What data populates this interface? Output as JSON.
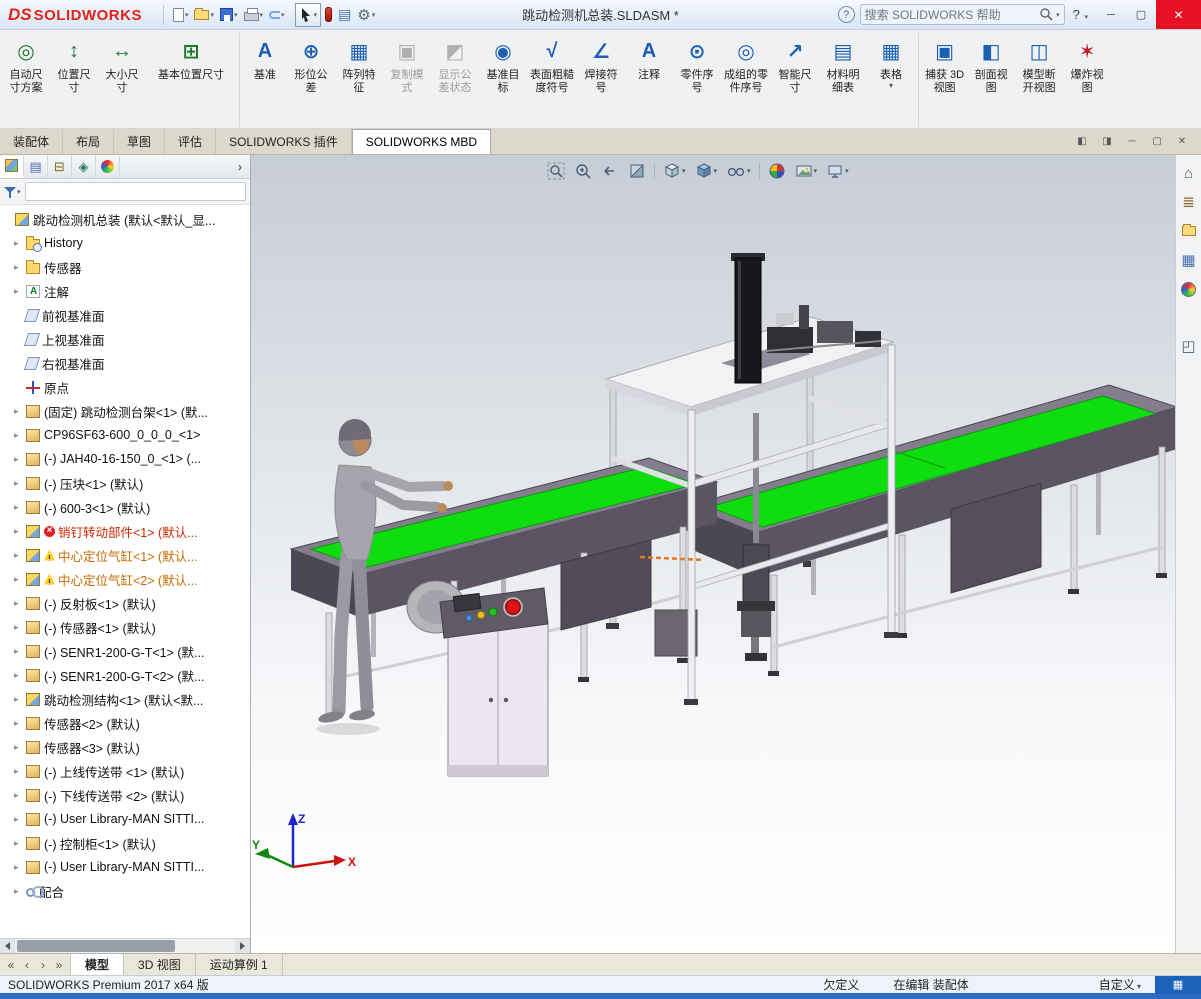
{
  "titlebar": {
    "logo_ds": "DS",
    "logo_name": "SOLIDWORKS",
    "title": "跳动检测机总装.SLDASM *",
    "search_placeholder": "搜索 SOLIDWORKS 帮助",
    "help_circle": "?",
    "help_btn": "?",
    "win_min": "─",
    "win_max": "▢",
    "win_close": "✕",
    "qat_icons": [
      "new-document",
      "open",
      "save",
      "print",
      "undo",
      "select-cursor",
      "rebuild",
      "file-properties",
      "options-gear"
    ]
  },
  "ribbon": {
    "buttons": [
      {
        "label": "自动尺\n寸方案",
        "glyph": "◎",
        "tone": "tg",
        "cls": "",
        "caret": ""
      },
      {
        "label": "位置尺\n寸",
        "glyph": "↕",
        "tone": "tg",
        "cls": "",
        "caret": ""
      },
      {
        "label": "大小尺\n寸",
        "glyph": "↔",
        "tone": "tg",
        "cls": "",
        "caret": ""
      },
      {
        "label": "基本位置尺寸",
        "glyph": "⊞",
        "tone": "tg",
        "cls": "wide",
        "caret": ""
      },
      {
        "label": "基准",
        "glyph": "A",
        "tone": "tb",
        "cls": "grp",
        "caret": ""
      },
      {
        "label": "形位公\n差",
        "glyph": "⊕",
        "tone": "tb",
        "cls": "",
        "caret": ""
      },
      {
        "label": "阵列特\n征",
        "glyph": "▦",
        "tone": "tb",
        "cls": "",
        "caret": ""
      },
      {
        "label": "复制模\n式",
        "glyph": "▣",
        "tone": "tk",
        "cls": "disabled",
        "caret": ""
      },
      {
        "label": "显示公\n差状态",
        "glyph": "◩",
        "tone": "tk",
        "cls": "disabled",
        "caret": ""
      },
      {
        "label": "基准目\n标",
        "glyph": "◉",
        "tone": "tb",
        "cls": "",
        "caret": ""
      },
      {
        "label": "表面粗糙\n度符号",
        "glyph": "√",
        "tone": "tb",
        "cls": "",
        "caret": ""
      },
      {
        "label": "焊接符\n号",
        "glyph": "∠",
        "tone": "tb",
        "cls": "",
        "caret": ""
      },
      {
        "label": "注释",
        "glyph": "A",
        "tone": "tb",
        "cls": "",
        "caret": ""
      },
      {
        "label": "零件序\n号",
        "glyph": "⊙",
        "tone": "tb",
        "cls": "",
        "caret": ""
      },
      {
        "label": "成组的零\n件序号",
        "glyph": "◎",
        "tone": "tb",
        "cls": "",
        "caret": ""
      },
      {
        "label": "智能尺\n寸",
        "glyph": "↗",
        "tone": "tb",
        "cls": "",
        "caret": ""
      },
      {
        "label": "材料明\n细表",
        "glyph": "▤",
        "tone": "tb",
        "cls": "",
        "caret": ""
      },
      {
        "label": "表格",
        "glyph": "▦",
        "tone": "tb",
        "cls": "",
        "caret": "▾"
      },
      {
        "label": "捕获 3D\n视图",
        "glyph": "▣",
        "tone": "tb",
        "cls": "grp",
        "caret": ""
      },
      {
        "label": "剖面视\n图",
        "glyph": "◧",
        "tone": "tb",
        "cls": "",
        "caret": ""
      },
      {
        "label": "模型断\n开视图",
        "glyph": "◫",
        "tone": "tb",
        "cls": "",
        "caret": ""
      },
      {
        "label": "爆炸视\n图",
        "glyph": "✶",
        "tone": "tr",
        "cls": "",
        "caret": ""
      }
    ]
  },
  "command_tabs": {
    "items": [
      {
        "label": "装配体",
        "cls": ""
      },
      {
        "label": "布局",
        "cls": ""
      },
      {
        "label": "草图",
        "cls": ""
      },
      {
        "label": "评估",
        "cls": ""
      },
      {
        "label": "SOLIDWORKS 插件",
        "cls": ""
      },
      {
        "label": "SOLIDWORKS MBD",
        "cls": "active"
      }
    ]
  },
  "doc_window_controls": [
    {
      "name": "tile-window-icon",
      "glyph": "◧"
    },
    {
      "name": "cascade-window-icon",
      "glyph": "◨"
    },
    {
      "name": "minimize-doc-icon",
      "glyph": "─"
    },
    {
      "name": "restore-doc-icon",
      "glyph": "▢"
    },
    {
      "name": "close-doc-icon",
      "glyph": "✕"
    }
  ],
  "feature_panel": {
    "manager_tabs": [
      "featuremanager-design-tree",
      "propertymanager",
      "configurationmanager",
      "dimxpertmanager",
      "displaymanager"
    ],
    "items": [
      {
        "label": "跳动检测机总装 (默认<默认_显...",
        "icon": "asm",
        "arrow": "",
        "cls": "root",
        "ovl": ""
      },
      {
        "label": "History",
        "icon": "folder-history",
        "arrow": "▸",
        "cls": "",
        "ovl": ""
      },
      {
        "label": "传感器",
        "icon": "folder",
        "arrow": "▸",
        "cls": "",
        "ovl": ""
      },
      {
        "label": "注解",
        "icon": "ann",
        "arrow": "▸",
        "cls": "",
        "ovl": ""
      },
      {
        "label": "前视基准面",
        "icon": "plane",
        "arrow": "",
        "cls": "",
        "ovl": ""
      },
      {
        "label": "上视基准面",
        "icon": "plane",
        "arrow": "",
        "cls": "",
        "ovl": ""
      },
      {
        "label": "右视基准面",
        "icon": "plane",
        "arrow": "",
        "cls": "",
        "ovl": ""
      },
      {
        "label": "原点",
        "icon": "origin",
        "arrow": "",
        "cls": "",
        "ovl": ""
      },
      {
        "label": "(固定) 跳动检测台架<1> (默...",
        "icon": "part",
        "arrow": "▸",
        "cls": "",
        "ovl": ""
      },
      {
        "label": "CP96SF63-600_0_0_0_<1>",
        "icon": "part",
        "arrow": "▸",
        "cls": "",
        "ovl": ""
      },
      {
        "label": "(-) JAH40-16-150_0_<1> (...",
        "icon": "part",
        "arrow": "▸",
        "cls": "",
        "ovl": ""
      },
      {
        "label": "(-) 压块<1> (默认)",
        "icon": "part",
        "arrow": "▸",
        "cls": "",
        "ovl": ""
      },
      {
        "label": "(-) 600-3<1> (默认)",
        "icon": "part",
        "arrow": "▸",
        "cls": "",
        "ovl": ""
      },
      {
        "label": "销钉转动部件<1> (默认...",
        "icon": "asm",
        "arrow": "▸",
        "cls": "error",
        "ovl": "error"
      },
      {
        "label": "中心定位气缸<1> (默认...",
        "icon": "asm",
        "arrow": "▸",
        "cls": "warn",
        "ovl": "warn"
      },
      {
        "label": "中心定位气缸<2> (默认...",
        "icon": "asm",
        "arrow": "▸",
        "cls": "warn",
        "ovl": "warn"
      },
      {
        "label": "(-) 反射板<1> (默认)",
        "icon": "part",
        "arrow": "▸",
        "cls": "",
        "ovl": ""
      },
      {
        "label": "(-) 传感器<1> (默认)",
        "icon": "part",
        "arrow": "▸",
        "cls": "",
        "ovl": ""
      },
      {
        "label": "(-) SENR1-200-G-T<1> (默...",
        "icon": "part",
        "arrow": "▸",
        "cls": "",
        "ovl": ""
      },
      {
        "label": "(-) SENR1-200-G-T<2> (默...",
        "icon": "part",
        "arrow": "▸",
        "cls": "",
        "ovl": ""
      },
      {
        "label": "跳动检测结构<1> (默认<默...",
        "icon": "asm",
        "arrow": "▸",
        "cls": "",
        "ovl": ""
      },
      {
        "label": "传感器<2> (默认)",
        "icon": "part",
        "arrow": "▸",
        "cls": "",
        "ovl": ""
      },
      {
        "label": "传感器<3> (默认)",
        "icon": "part",
        "arrow": "▸",
        "cls": "",
        "ovl": ""
      },
      {
        "label": "(-) 上线传送带 <1> (默认)",
        "icon": "part",
        "arrow": "▸",
        "cls": "",
        "ovl": ""
      },
      {
        "label": "(-) 下线传送带 <2> (默认)",
        "icon": "part",
        "arrow": "▸",
        "cls": "",
        "ovl": ""
      },
      {
        "label": "(-) User Library-MAN SITTI...",
        "icon": "part",
        "arrow": "▸",
        "cls": "",
        "ovl": ""
      },
      {
        "label": "(-) 控制柜<1> (默认)",
        "icon": "part",
        "arrow": "▸",
        "cls": "",
        "ovl": ""
      },
      {
        "label": "(-) User Library-MAN SITTI...",
        "icon": "part",
        "arrow": "▸",
        "cls": "",
        "ovl": ""
      },
      {
        "label": "配合",
        "icon": "mates",
        "arrow": "▸",
        "cls": "",
        "ovl": ""
      }
    ]
  },
  "viewport": {
    "hud_icons": [
      "zoom-to-fit",
      "zoom-to-area",
      "previous-view",
      "section-view",
      "view-orientation",
      "display-style",
      "hide-show-items",
      "edit-appearance",
      "apply-scene",
      "view-settings"
    ],
    "triad": {
      "x": "X",
      "y": "Y",
      "z": "Z"
    },
    "colors": {
      "belt_green": "#0fdd0f",
      "frame_dark": "#5b5563",
      "background_top": "#c7cdd6",
      "background_bottom": "#ffffff"
    }
  },
  "taskpane": {
    "icons": [
      "solidworks-resources",
      "design-library",
      "file-explorer",
      "view-palette",
      "appearances-scenes",
      "pane-toggle"
    ]
  },
  "bottom_tabs": {
    "nav": [
      {
        "glyph": "«"
      },
      {
        "glyph": "‹"
      },
      {
        "glyph": "›"
      },
      {
        "glyph": "»"
      }
    ],
    "items": [
      {
        "label": "模型",
        "cls": "active"
      },
      {
        "label": "3D 视图",
        "cls": ""
      },
      {
        "label": "运动算例 1",
        "cls": ""
      }
    ]
  },
  "statusbar": {
    "left": "SOLIDWORKS Premium 2017 x64 版",
    "state": "欠定义",
    "editing": "在编辑 装配体",
    "custom": "自定义"
  }
}
